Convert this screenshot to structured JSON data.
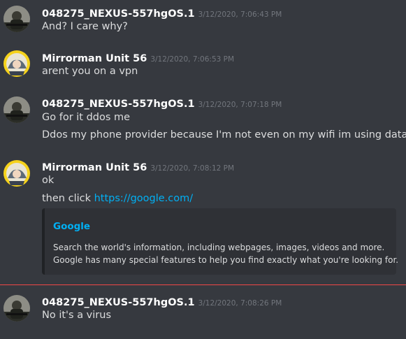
{
  "messages": [
    {
      "author": "048275_NEXUS-557hgOS.1",
      "timestamp": "3/12/2020, 7:06:43 PM",
      "lines": [
        "And? I care why?"
      ],
      "avatar": "soldier-avatar"
    },
    {
      "author": "Mirrorman Unit 56",
      "timestamp": "3/12/2020, 7:06:53 PM",
      "lines": [
        "arent you on a vpn"
      ],
      "avatar": "anime-avatar"
    },
    {
      "author": "048275_NEXUS-557hgOS.1",
      "timestamp": "3/12/2020, 7:07:18 PM",
      "lines": [
        "Go for it ddos me",
        "Ddos my phone provider because I'm not even on my wifi im using data"
      ],
      "avatar": "soldier-avatar"
    },
    {
      "author": "Mirrorman Unit 56",
      "timestamp": "3/12/2020, 7:08:12 PM",
      "lines": [
        "ok"
      ],
      "link_line": {
        "prefix": "then click ",
        "url": "https://google.com/"
      },
      "avatar": "anime-avatar"
    },
    {
      "author": "048275_NEXUS-557hgOS.1",
      "timestamp": "3/12/2020, 7:08:26 PM",
      "lines": [
        "No it's a virus"
      ],
      "avatar": "soldier-avatar"
    }
  ],
  "embed": {
    "title": "Google",
    "description_lines": [
      "Search the world's information, including webpages, images, videos and more.",
      "Google has many special features to help you find exactly what you're looking for."
    ]
  },
  "colors": {
    "background": "#36393f",
    "link": "#00b0f4",
    "new_divider": "#f04747",
    "embed_bg": "#2f3136"
  }
}
